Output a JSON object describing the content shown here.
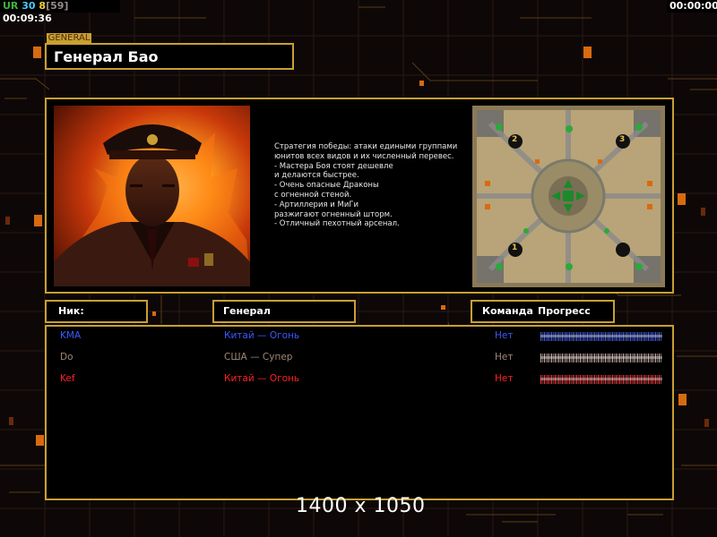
{
  "hud": {
    "ur": "UR",
    "n1": "30",
    "n2": "8",
    "bracket": "[59]",
    "time_left": "00:09:36",
    "time_right": "00:00:00"
  },
  "section_label": "GENERAL",
  "general_title": "Генерал Бао",
  "description": [
    "Стратегия победы: атаки едиными группами",
    "юнитов всех видов и их численный перевес.",
    "",
    "- Мастера Боя стоят дешевле",
    "и делаются быстрее.",
    "- Очень опасные Драконы",
    "с огненной стеной.",
    "",
    "- Артиллерия и МиГи",
    "разжигают огненный шторм.",
    "- Отличный пехотный арсенал."
  ],
  "minimap_markers": [
    "1",
    "2",
    "3"
  ],
  "headers": {
    "nick": "Ник:",
    "general": "Генерал",
    "team": "Команда",
    "progress": "Прогресс"
  },
  "players": [
    {
      "nick": "KMA",
      "general": "Китай — Огонь",
      "team": "Нет",
      "color": "#3a5aff",
      "bar_color": "#3a5aff",
      "progress": 1.0
    },
    {
      "nick": "Do",
      "general": "США — Супер",
      "team": "Нет",
      "color": "#a08878",
      "bar_color": "#c8aaa0",
      "progress": 1.0
    },
    {
      "nick": "Kef",
      "general": "Китай — Огонь",
      "team": "Нет",
      "color": "#ff2020",
      "bar_color": "#ff3030",
      "progress": 1.0
    }
  ],
  "resolution_overlay": "1400 x 1050",
  "colors": {
    "accent": "#c8a032",
    "background": "#0d0807"
  }
}
